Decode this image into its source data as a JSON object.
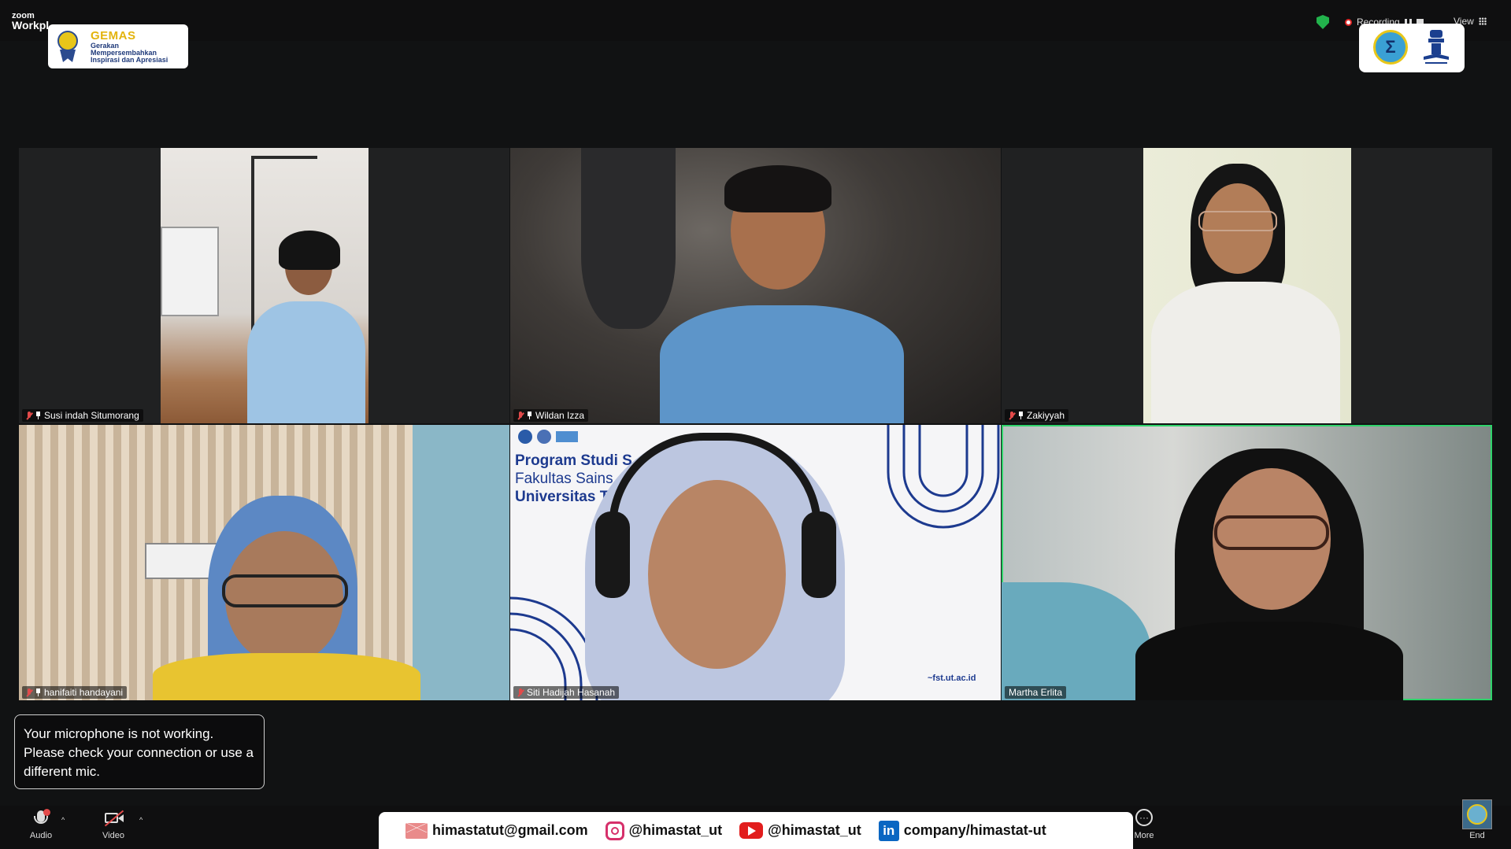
{
  "app": {
    "logo_line1": "zoom",
    "logo_line2": "Workpl"
  },
  "gemas": {
    "title": "GEMAS",
    "subtitle": "Gerakan Mempersembahkan Inspirasi dan Apresiasi"
  },
  "status": {
    "recording_label": "Recording",
    "view_label": "View"
  },
  "participants": [
    {
      "name": "Susi indah Situmorang",
      "muted": true
    },
    {
      "name": "Wildan Izza",
      "muted": true
    },
    {
      "name": "Zakiyyah",
      "muted": true
    },
    {
      "name": "hanifaiti handayani",
      "muted": true
    },
    {
      "name": "Siti Hadijah Hasanah",
      "muted": true
    },
    {
      "name": "Martha Erlita",
      "muted": false,
      "active_speaker": true
    }
  ],
  "slide_text": {
    "line1": "Program Studi S",
    "line2": "Fakultas Sains",
    "line3": "Universitas T",
    "url": "~fst.ut.ac.id"
  },
  "notice": {
    "text": "Your microphone is not working. Please check your connection or use a different mic."
  },
  "toolbar": {
    "audio_label": "Audio",
    "video_label": "Video",
    "more_label": "More",
    "end_label": "End"
  },
  "social": {
    "email": "himastatut@gmail.com",
    "instagram": "@himastat_ut",
    "youtube": "@himastat_ut",
    "linkedin": "company/himastat-ut"
  },
  "colors": {
    "active_speaker_border": "#2fd36b",
    "recording_icon": "#22b24c",
    "muted_mic": "#e24a4a"
  }
}
